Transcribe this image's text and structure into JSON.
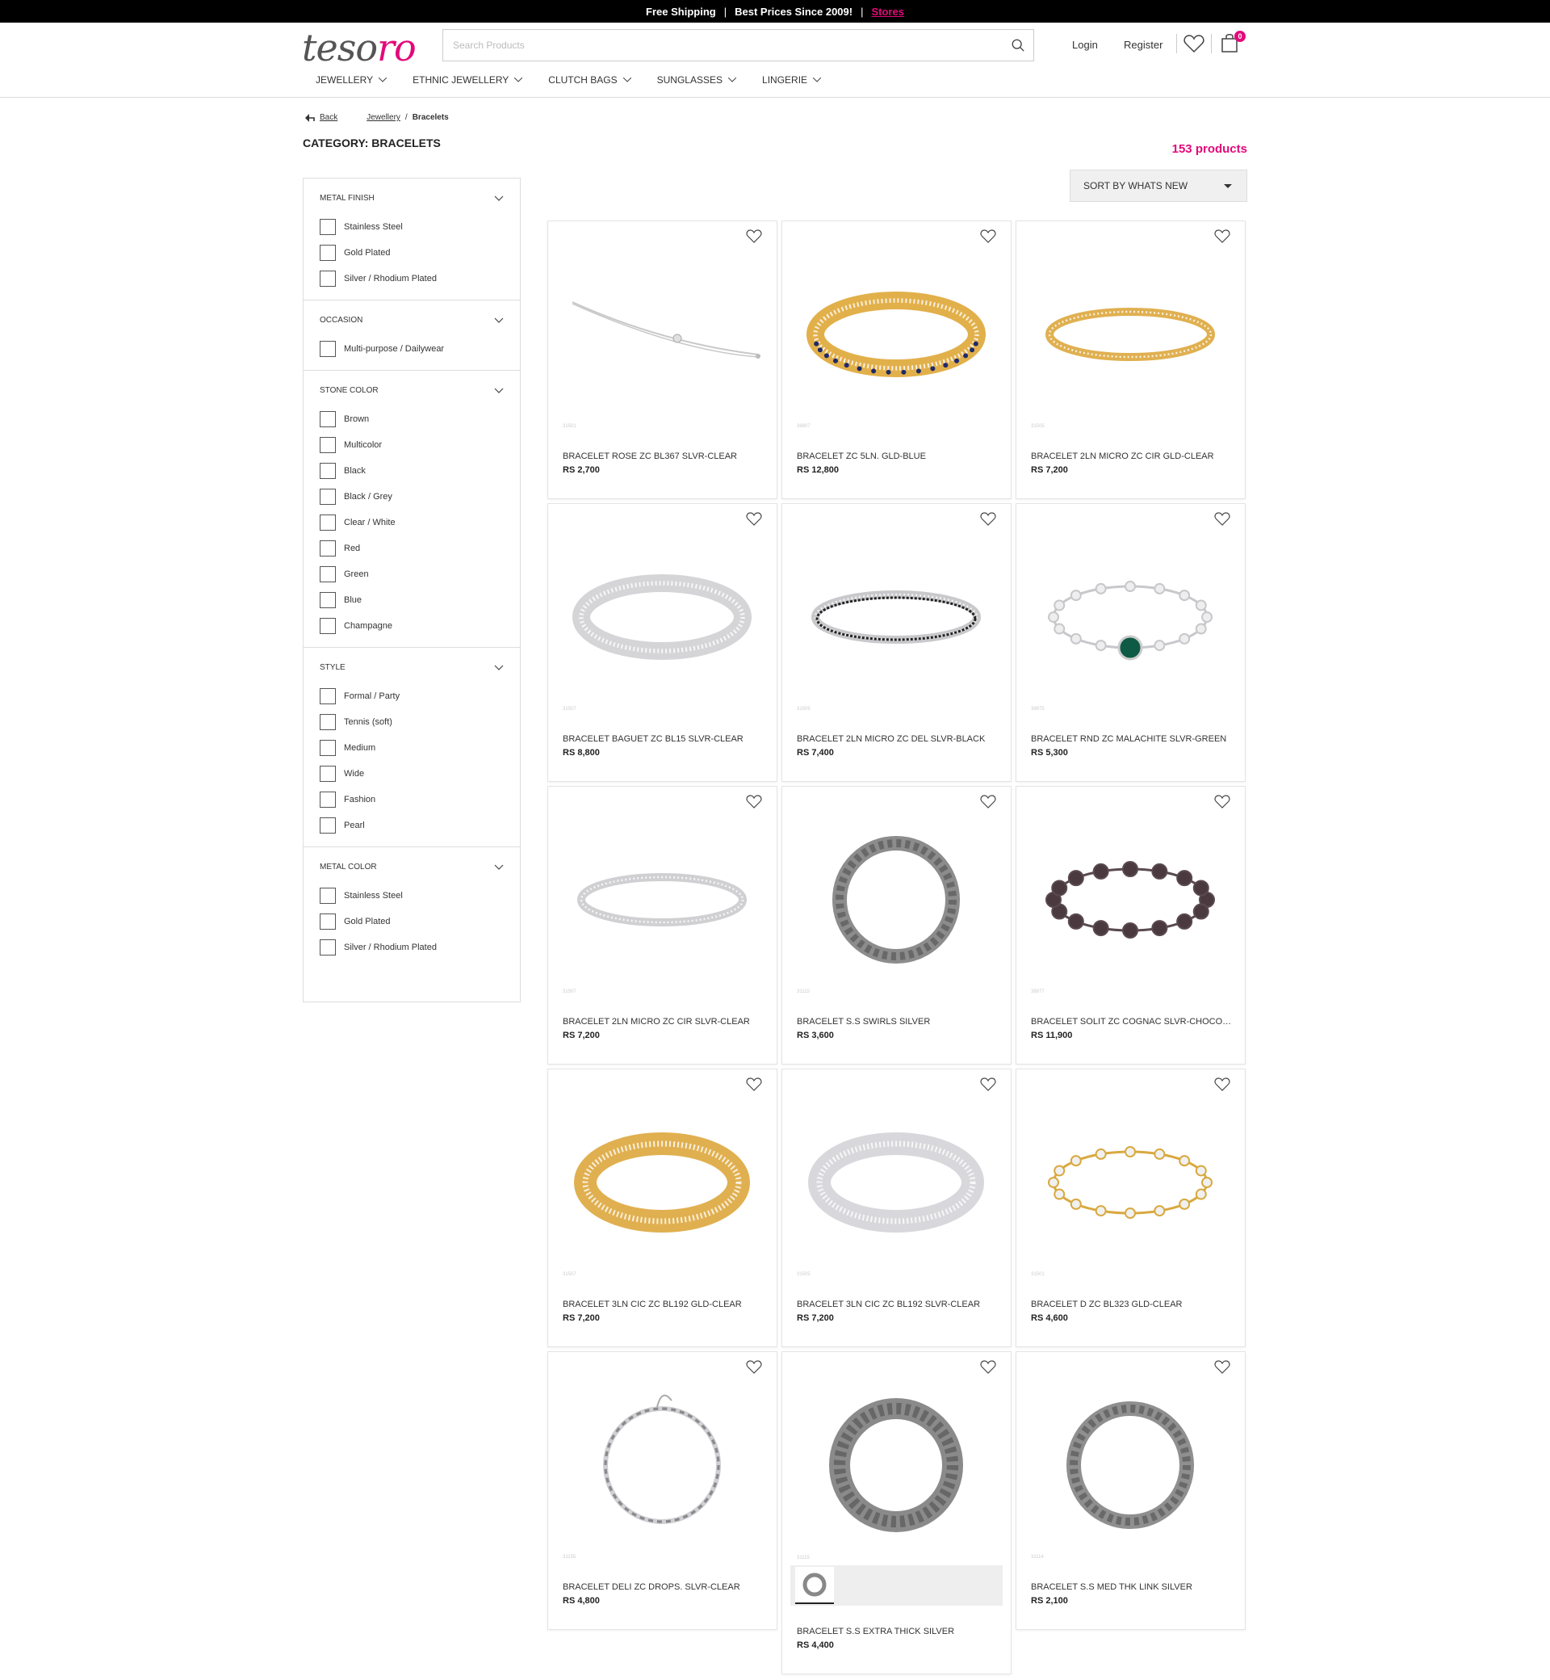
{
  "topbar": {
    "shipping": "Free Shipping",
    "sep1": "|",
    "prices": "Best Prices Since 2009!",
    "sep2": "|",
    "stores": "Stores"
  },
  "header": {
    "logo_part1": "teso",
    "logo_part2": "ro",
    "search_placeholder": "Search Products",
    "login": "Login",
    "register": "Register",
    "cart_count": "0"
  },
  "nav": [
    "JEWELLERY",
    "ETHNIC JEWELLERY",
    "CLUTCH BAGS",
    "SUNGLASSES",
    "LINGERIE"
  ],
  "breadcrumb": {
    "back": "Back",
    "jewellery": "Jewellery",
    "sep": "/",
    "current": "Bracelets"
  },
  "category_title": "CATEGORY: BRACELETS",
  "product_count": "153 products",
  "sort_label": "SORT BY WHATS NEW",
  "filters": [
    {
      "title": "METAL FINISH",
      "options": [
        "Stainless Steel",
        "Gold Plated",
        "Silver / Rhodium Plated"
      ]
    },
    {
      "title": "OCCASION",
      "options": [
        "Multi-purpose / Dailywear"
      ]
    },
    {
      "title": "STONE COLOR",
      "options": [
        "Brown",
        "Multicolor",
        "Black",
        "Black / Grey",
        "Clear / White",
        "Red",
        "Green",
        "Blue",
        "Champagne"
      ]
    },
    {
      "title": "STYLE",
      "options": [
        "Formal / Party",
        "Tennis (soft)",
        "Medium",
        "Wide",
        "Fashion",
        "Pearl"
      ]
    },
    {
      "title": "METAL COLOR",
      "options": [
        "Stainless Steel",
        "Gold Plated",
        "Silver / Rhodium Plated"
      ]
    }
  ],
  "products": [
    {
      "name": "BRACELET ROSE ZC BL367 SLVR-CLEAR",
      "price": "RS 2,700",
      "sku": "31501",
      "kind": "chain-fine",
      "metal": "#c8c8c8"
    },
    {
      "name": "BRACELET ZC 5LN. GLD-BLUE",
      "price": "RS 12,800",
      "sku": "38807",
      "kind": "bangle-wide",
      "metal": "#e2b04a"
    },
    {
      "name": "BRACELET 2LN MICRO ZC CIR GLD-CLEAR",
      "price": "RS 7,200",
      "sku": "31505",
      "kind": "bangle",
      "metal": "#e0b050"
    },
    {
      "name": "BRACELET BAGUET ZC BL15 SLVR-CLEAR",
      "price": "RS 8,800",
      "sku": "31507",
      "kind": "bangle-wide",
      "metal": "#d5d5d8"
    },
    {
      "name": "BRACELET 2LN MICRO ZC DEL SLVR-BLACK",
      "price": "RS 7,400",
      "sku": "31505",
      "kind": "bangle",
      "metal": "#c9c9cc"
    },
    {
      "name": "BRACELET RND ZC MALACHITE SLVR-GREEN",
      "price": "RS 5,300",
      "sku": "38875",
      "kind": "tennis-charm",
      "metal": "#c8c8cc"
    },
    {
      "name": "BRACELET 2LN MICRO ZC CIR SLVR-CLEAR",
      "price": "RS 7,200",
      "sku": "31507",
      "kind": "bangle",
      "metal": "#d0d0d3"
    },
    {
      "name": "BRACELET S.S SWIRLS SILVER",
      "price": "RS 3,600",
      "sku": "31115",
      "kind": "chain-round",
      "metal": "#8c8c8c"
    },
    {
      "name": "BRACELET SOLIT ZC COGNAC SLVR-CHOCOLATE",
      "price": "RS 11,900",
      "sku": "38877",
      "kind": "tennis-dark",
      "metal": "#5a4a4e"
    },
    {
      "name": "BRACELET 3LN CIC ZC BL192 GLD-CLEAR",
      "price": "RS 7,200",
      "sku": "31507",
      "kind": "cuff",
      "metal": "#e0b050"
    },
    {
      "name": "BRACELET 3LN CIC ZC BL192 SLVR-CLEAR",
      "price": "RS 7,200",
      "sku": "31505",
      "kind": "cuff",
      "metal": "#d8d8dc"
    },
    {
      "name": "BRACELET D ZC BL323 GLD-CLEAR",
      "price": "RS 4,600",
      "sku": "31501",
      "kind": "tennis-gold",
      "metal": "#d9a940"
    },
    {
      "name": "BRACELET DELI ZC DROPS. SLVR-CLEAR",
      "price": "RS 4,800",
      "sku": "31155",
      "kind": "chain-round-fine",
      "metal": "#d0d0d4"
    },
    {
      "name": "BRACELET S.S EXTRA THICK SILVER",
      "price": "RS 4,400",
      "sku": "31115",
      "kind": "chain-round-thick",
      "metal": "#8a8a8a"
    },
    {
      "name": "BRACELET S.S MED THK LINK SILVER",
      "price": "RS 2,100",
      "sku": "31114",
      "kind": "chain-round",
      "metal": "#8f8f8f"
    }
  ],
  "colors": {
    "accent": "#e3097a",
    "topbar_bg": "#000000"
  },
  "icons": {
    "search": "search-icon",
    "wishlist": "heart-icon",
    "cart": "shopping-bag-icon",
    "back": "back-arrow-icon"
  }
}
